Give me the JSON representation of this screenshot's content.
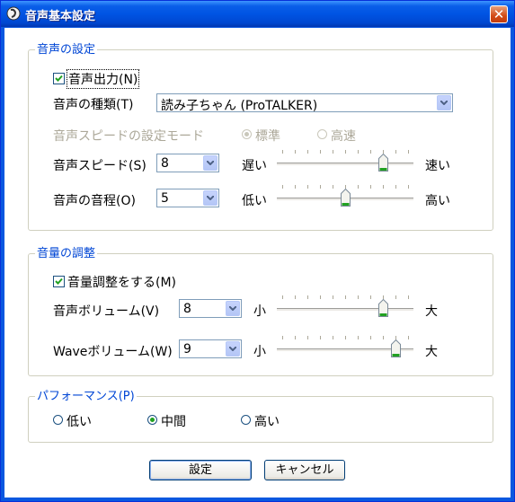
{
  "window": {
    "title": "音声基本設定",
    "close_label": "✕"
  },
  "voice_settings": {
    "legend": "音声の設定",
    "output_checkbox": {
      "label": "音声出力(N)",
      "checked": true
    },
    "voice_type": {
      "label": "音声の種類(T)",
      "value": "読み子ちゃん (ProTALKER)"
    },
    "speed_mode": {
      "label": "音声スピードの設定モード",
      "options": [
        "標準",
        "高速"
      ],
      "selected": "標準",
      "disabled": true
    },
    "speed": {
      "label": "音声スピード(S)",
      "value": "8",
      "low_label": "遅い",
      "high_label": "速い",
      "level": 0.8
    },
    "pitch": {
      "label": "音声の音程(O)",
      "value": "5",
      "low_label": "低い",
      "high_label": "高い",
      "level": 0.5
    }
  },
  "volume_settings": {
    "legend": "音量の調整",
    "adjust_checkbox": {
      "label": "音量調整をする(M)",
      "checked": true
    },
    "voice_volume": {
      "label": "音声ボリューム(V)",
      "value": "8",
      "low_label": "小",
      "high_label": "大",
      "level": 0.8
    },
    "wave_volume": {
      "label": "Waveボリューム(W)",
      "value": "9",
      "low_label": "小",
      "high_label": "大",
      "level": 0.9
    }
  },
  "performance": {
    "legend": "パフォーマンス(P)",
    "options": [
      "低い",
      "中間",
      "高い"
    ],
    "selected": "中間"
  },
  "buttons": {
    "ok": "設定",
    "cancel": "キャンセル"
  }
}
